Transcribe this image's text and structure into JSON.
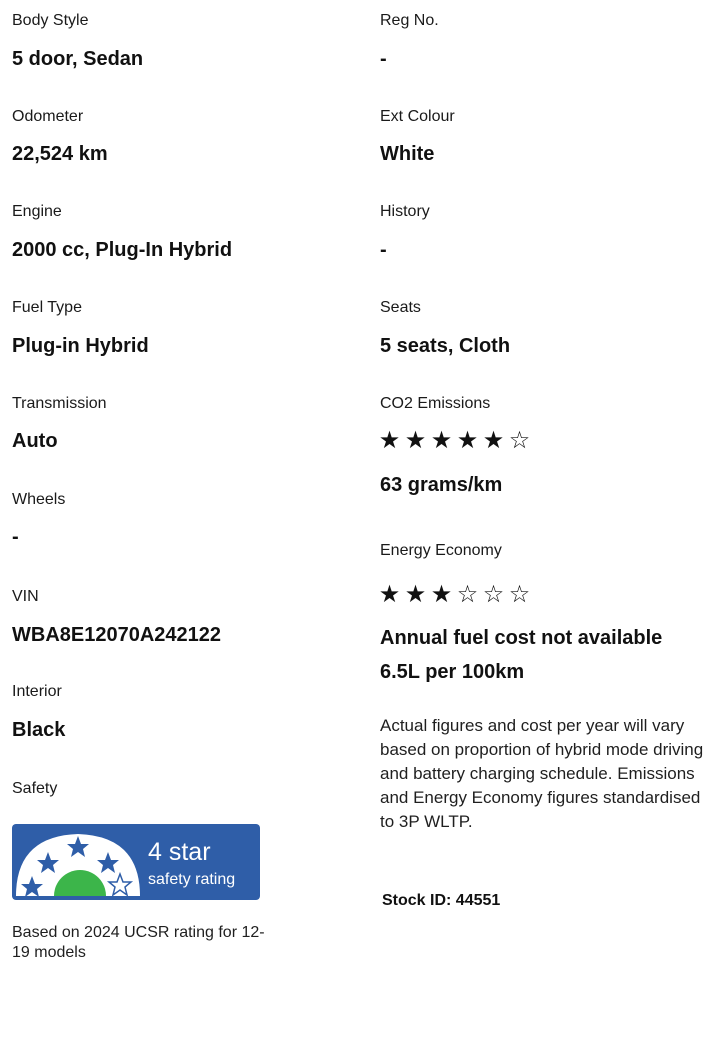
{
  "left": {
    "body_style": {
      "label": "Body Style",
      "value": "5 door, Sedan"
    },
    "odometer": {
      "label": "Odometer",
      "value": "22,524 km"
    },
    "engine": {
      "label": "Engine",
      "value": "2000 cc, Plug-In Hybrid"
    },
    "fuel_type": {
      "label": "Fuel Type",
      "value": "Plug-in Hybrid"
    },
    "transmission": {
      "label": "Transmission",
      "value": "Auto"
    },
    "wheels": {
      "label": "Wheels",
      "value": "-"
    },
    "vin": {
      "label": "VIN",
      "value": "WBA8E12070A242122"
    },
    "interior": {
      "label": "Interior",
      "value": "Black"
    },
    "safety": {
      "label": "Safety",
      "badge_rating": "4 star",
      "badge_caption": "safety rating",
      "stars": 4,
      "note": "Based on 2024 UCSR rating for 12-19 models"
    }
  },
  "right": {
    "reg_no": {
      "label": "Reg No.",
      "value": "-"
    },
    "ext_colour": {
      "label": "Ext Colour",
      "value": "White"
    },
    "history": {
      "label": "History",
      "value": "-"
    },
    "seats": {
      "label": "Seats",
      "value": "5 seats, Cloth"
    },
    "co2": {
      "label": "CO2 Emissions",
      "rating": 5,
      "max": 6,
      "value": "63 grams/km"
    },
    "energy": {
      "label": "Energy Economy",
      "rating": 3,
      "max": 6
    },
    "fuel_cost": "Annual fuel cost not available",
    "fuel_consumption": "6.5L per 100km",
    "disclaimer": "Actual figures and cost per year will vary based on proportion of hybrid mode driving and battery charging schedule. Emissions and Energy Economy figures standardised to 3P WLTP.",
    "stock_id": "Stock ID: 44551"
  },
  "colors": {
    "badge_blue": "#2f5ea8",
    "badge_green": "#3cb54a",
    "text": "#111111"
  },
  "icons": {
    "filled_star": "filled-star-icon",
    "empty_star": "empty-star-icon"
  }
}
